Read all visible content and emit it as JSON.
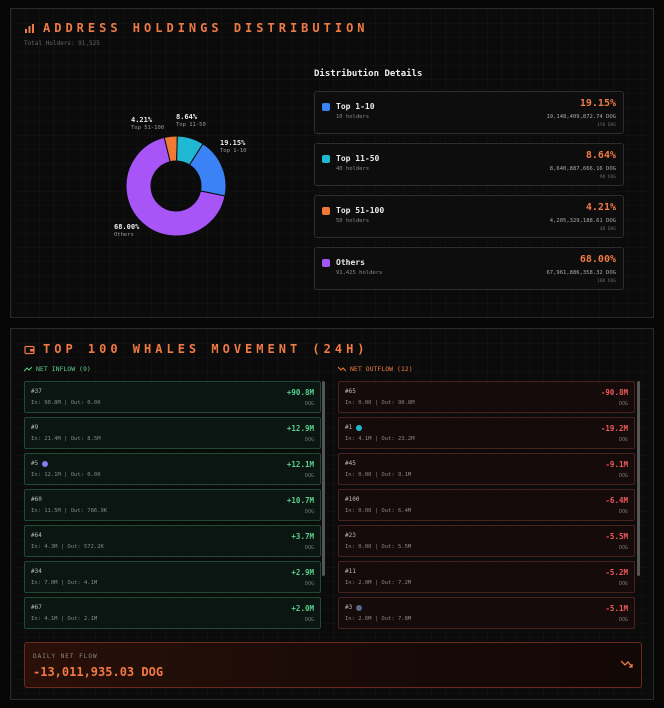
{
  "distribution": {
    "title": "ADDRESS HOLDINGS DISTRIBUTION",
    "total_holders": "Total Holders: 91,525",
    "details_title": "Distribution Details",
    "chart_data": {
      "type": "pie",
      "categories": [
        "Top 1-10",
        "Top 11-50",
        "Top 51-100",
        "Others"
      ],
      "values": [
        19.15,
        8.64,
        4.21,
        68.0
      ],
      "labels": [
        "19.15%",
        "8.64%",
        "4.21%",
        "68.00%"
      ],
      "colors": [
        "#3b82f6",
        "#1fb8d2",
        "#f07a35",
        "#a855f7"
      ]
    },
    "cards": [
      {
        "label": "Top 1-10",
        "holders": "10 holders",
        "percent": "19.15%",
        "amount": "19,148,409,872.74 DOG",
        "sub": "1YB DOG",
        "color": "#3b82f6"
      },
      {
        "label": "Top 11-50",
        "holders": "40 holders",
        "percent": "8.64%",
        "amount": "8,640,887,666.16 DOG",
        "sub": "9B DOG",
        "color": "#1fb8d2"
      },
      {
        "label": "Top 51-100",
        "holders": "50 holders",
        "percent": "4.21%",
        "amount": "4,205,329,188.61 DOG",
        "sub": "4B DOG",
        "color": "#f07a35"
      },
      {
        "label": "Others",
        "holders": "91,425 holders",
        "percent": "68.00%",
        "amount": "67,961,886,358.32 DOG",
        "sub": "18B DOG",
        "color": "#a855f7"
      }
    ]
  },
  "whales": {
    "title": "TOP 100 WHALES MOVEMENT (24H)",
    "inflow_label": "NET INFLOW (9)",
    "outflow_label": "NET OUTFLOW (12)",
    "unit": "DOG",
    "inflow": [
      {
        "rank": "#37",
        "io": "In: 90.8M | Out: 0.00",
        "value": "+90.8M",
        "badge": ""
      },
      {
        "rank": "#9",
        "io": "In: 21.4M | Out: 8.5M",
        "value": "+12.9M",
        "badge": ""
      },
      {
        "rank": "#5",
        "io": "In: 12.1M | Out: 0.00",
        "value": "+12.1M",
        "badge": "#8a7af0"
      },
      {
        "rank": "#60",
        "io": "In: 11.5M | Out: 786.9K",
        "value": "+10.7M",
        "badge": ""
      },
      {
        "rank": "#64",
        "io": "In: 4.3M | Out: 572.2K",
        "value": "+3.7M",
        "badge": ""
      },
      {
        "rank": "#34",
        "io": "In: 7.0M | Out: 4.1M",
        "value": "+2.9M",
        "badge": ""
      },
      {
        "rank": "#67",
        "io": "In: 4.1M | Out: 2.1M",
        "value": "+2.0M",
        "badge": ""
      }
    ],
    "outflow": [
      {
        "rank": "#65",
        "io": "In: 0.00 | Out: 90.8M",
        "value": "-90.8M",
        "badge": ""
      },
      {
        "rank": "#1",
        "io": "In: 4.1M | Out: 23.2M",
        "value": "-19.2M",
        "badge": "#1fb8d2"
      },
      {
        "rank": "#45",
        "io": "In: 0.00 | Out: 9.1M",
        "value": "-9.1M",
        "badge": ""
      },
      {
        "rank": "#100",
        "io": "In: 0.00 | Out: 6.4M",
        "value": "-6.4M",
        "badge": ""
      },
      {
        "rank": "#23",
        "io": "In: 0.00 | Out: 5.5M",
        "value": "-5.5M",
        "badge": ""
      },
      {
        "rank": "#11",
        "io": "In: 2.0M | Out: 7.2M",
        "value": "-5.2M",
        "badge": ""
      },
      {
        "rank": "#3",
        "io": "In: 2.6M | Out: 7.8M",
        "value": "-5.1M",
        "badge": "#5a6a8a"
      }
    ],
    "net_flow_label": "DAILY NET FLOW",
    "net_flow_value": "-13,011,935.03 DOG"
  }
}
